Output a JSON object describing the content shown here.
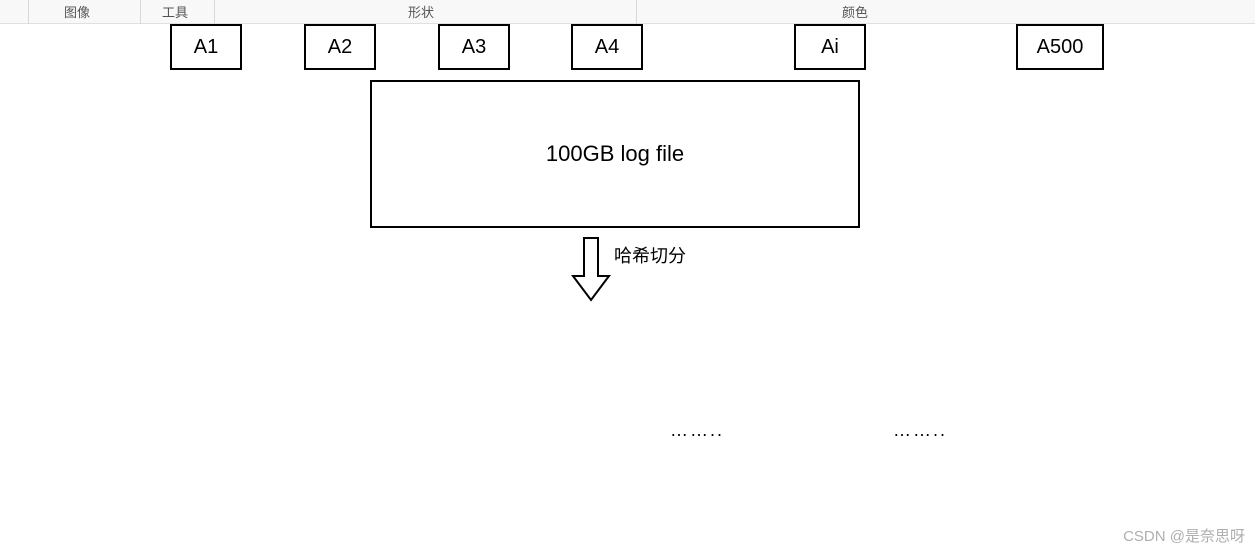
{
  "toolbar": {
    "tab_image": "图像",
    "tab_tools": "工具",
    "tab_shape": "形状",
    "tab_color": "颜色"
  },
  "diagram": {
    "main_box_label": "100GB log file",
    "arrow_label": "哈希切分",
    "splits": {
      "a1": "A1",
      "a2": "A2",
      "a3": "A3",
      "a4": "A4",
      "ai": "Ai",
      "a500": "A500"
    },
    "ellipsis1": "……..",
    "ellipsis2": "…….."
  },
  "watermark": "CSDN @是奈思呀"
}
